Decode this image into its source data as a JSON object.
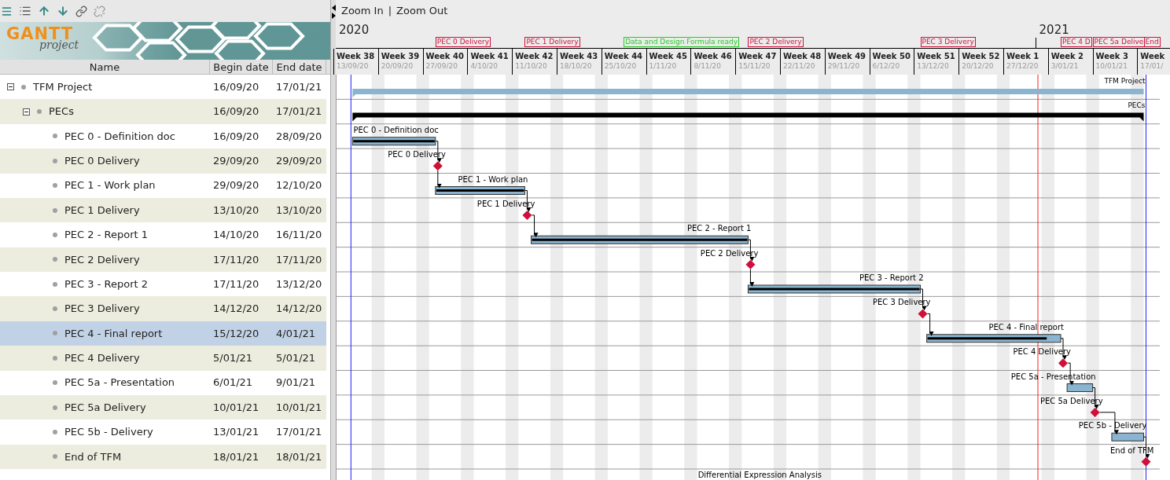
{
  "logo": {
    "title": "GANTT",
    "subtitle": "project"
  },
  "columns": [
    "Name",
    "Begin date",
    "End date"
  ],
  "zoom": {
    "zoom_in": "Zoom In",
    "separator": "|",
    "zoom_out": "Zoom Out"
  },
  "weeks": [
    {
      "label": "Week 38",
      "date": "13/09/20",
      "year": "2020"
    },
    {
      "label": "Week 39",
      "date": "20/09/20"
    },
    {
      "label": "Week 40",
      "date": "27/09/20"
    },
    {
      "label": "Week 41",
      "date": "4/10/20"
    },
    {
      "label": "Week 42",
      "date": "11/10/20"
    },
    {
      "label": "Week 43",
      "date": "18/10/20"
    },
    {
      "label": "Week 44",
      "date": "25/10/20",
      "flag": {
        "label": "Data and Design Formula ready",
        "color": "#22cc22"
      }
    },
    {
      "label": "Week 45",
      "date": "1/11/20"
    },
    {
      "label": "Week 46",
      "date": "8/11/20"
    },
    {
      "label": "Week 47",
      "date": "15/11/20"
    },
    {
      "label": "Week 48",
      "date": "22/11/20"
    },
    {
      "label": "Week 49",
      "date": "29/11/20"
    },
    {
      "label": "Week 50",
      "date": "6/12/20"
    },
    {
      "label": "Week 51",
      "date": "13/12/20"
    },
    {
      "label": "Week 52",
      "date": "20/12/20"
    },
    {
      "label": "Week 1",
      "date": "27/12/20",
      "year": "2021"
    },
    {
      "label": "Week 2",
      "date": "3/01/21"
    },
    {
      "label": "Week 3",
      "date": "10/01/21"
    },
    {
      "label": "Week",
      "date": "17/01/"
    }
  ],
  "tasks": [
    {
      "kind": "project",
      "name": "TFM Project",
      "begin": "16/09/20",
      "end": "17/01/21",
      "chart_label": "TFM Project",
      "expanded": true,
      "selected": false,
      "children": [
        {
          "kind": "summary",
          "name": "PECs",
          "begin": "16/09/20",
          "end": "17/01/21",
          "chart_label": "PECs",
          "expanded": true,
          "selected": false,
          "children": [
            {
              "kind": "task",
              "name": "PEC 0 - Definition doc",
              "begin": "16/09/20",
              "end": "28/09/20",
              "chart_label": "PEC 0 - Definition doc",
              "level": 1,
              "selected": false
            },
            {
              "kind": "milestone",
              "name": "PEC 0 Delivery",
              "begin": "29/09/20",
              "end": "29/09/20",
              "chart_label": "PEC 0 Delivery",
              "flag": {
                "label": "PEC 0 Delivery",
                "color": "#d0103a"
              },
              "selected": false
            },
            {
              "kind": "task",
              "name": "PEC 1 - Work plan",
              "begin": "29/09/20",
              "end": "12/10/20",
              "chart_label": "PEC 1 - Work plan",
              "level": 1,
              "selected": false
            },
            {
              "kind": "milestone",
              "name": "PEC 1 Delivery",
              "begin": "13/10/20",
              "end": "13/10/20",
              "chart_label": "PEC 1 Delivery",
              "flag": {
                "label": "PEC 1 Delivery",
                "color": "#d0103a"
              },
              "selected": false
            },
            {
              "kind": "task",
              "name": "PEC 2 - Report 1",
              "begin": "14/10/20",
              "end": "16/11/20",
              "chart_label": "PEC 2 - Report 1",
              "level": 1,
              "selected": false
            },
            {
              "kind": "milestone",
              "name": "PEC 2 Delivery",
              "begin": "17/11/20",
              "end": "17/11/20",
              "chart_label": "PEC 2 Delivery",
              "flag": {
                "label": "PEC 2 Delivery",
                "color": "#d0103a"
              },
              "selected": false
            },
            {
              "kind": "task",
              "name": "PEC 3 - Report 2",
              "begin": "17/11/20",
              "end": "13/12/20",
              "chart_label": "PEC 3 - Report 2",
              "level": 1,
              "selected": false
            },
            {
              "kind": "milestone",
              "name": "PEC 3 Delivery",
              "begin": "14/12/20",
              "end": "14/12/20",
              "chart_label": "PEC 3 Delivery",
              "flag": {
                "label": "PEC 3 Delivery",
                "color": "#d0103a"
              },
              "selected": false
            },
            {
              "kind": "task",
              "name": "PEC 4 - Final report",
              "begin": "15/12/20",
              "end": "4/01/21",
              "chart_label": "PEC 4 - Final report",
              "level": 0.9,
              "selected": true
            },
            {
              "kind": "milestone",
              "name": "PEC 4 Delivery",
              "begin": "5/01/21",
              "end": "5/01/21",
              "chart_label": "PEC 4 Delivery",
              "flag": {
                "label": "PEC 4 D",
                "color": "#d0103a"
              },
              "selected": false
            },
            {
              "kind": "task",
              "name": "PEC 5a - Presentation",
              "begin": "6/01/21",
              "end": "9/01/21",
              "chart_label": "PEC 5a - Presentation",
              "selected": false
            },
            {
              "kind": "milestone",
              "name": "PEC 5a Delivery",
              "begin": "10/01/21",
              "end": "10/01/21",
              "chart_label": "PEC 5a Delivery",
              "flag": {
                "label": "PEC 5a Delive",
                "color": "#d0103a"
              },
              "selected": false
            },
            {
              "kind": "task",
              "name": "PEC 5b - Delivery",
              "begin": "13/01/21",
              "end": "17/01/21",
              "chart_label": "PEC 5b - Delivery",
              "selected": false
            },
            {
              "kind": "milestone",
              "name": "End of TFM",
              "begin": "18/01/21",
              "end": "18/01/21",
              "chart_label": "End of TFM",
              "flag": {
                "label": "End",
                "color": "#d0103a"
              },
              "selected": false
            }
          ]
        }
      ]
    }
  ],
  "footer_label": "Differential Expression Analysis"
}
